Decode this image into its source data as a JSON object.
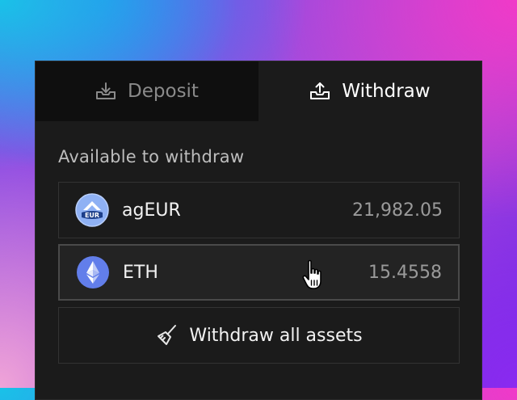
{
  "tabs": {
    "deposit_label": "Deposit",
    "withdraw_label": "Withdraw",
    "active": "withdraw"
  },
  "section_title": "Available to withdraw",
  "assets": [
    {
      "symbol": "agEUR",
      "icon": "ageur-token-icon",
      "icon_label": "EUR",
      "amount": "21,982.05",
      "selected": false
    },
    {
      "symbol": "ETH",
      "icon": "eth-token-icon",
      "amount": "15.4558",
      "selected": true
    }
  ],
  "withdraw_all_label": "Withdraw all assets",
  "colors": {
    "panel_bg": "#1b1b1b",
    "inactive_tab_bg": "#0f0f0f",
    "eth_icon_bg": "#627eea",
    "ageur_icon_bg": "#8fb1f4"
  }
}
